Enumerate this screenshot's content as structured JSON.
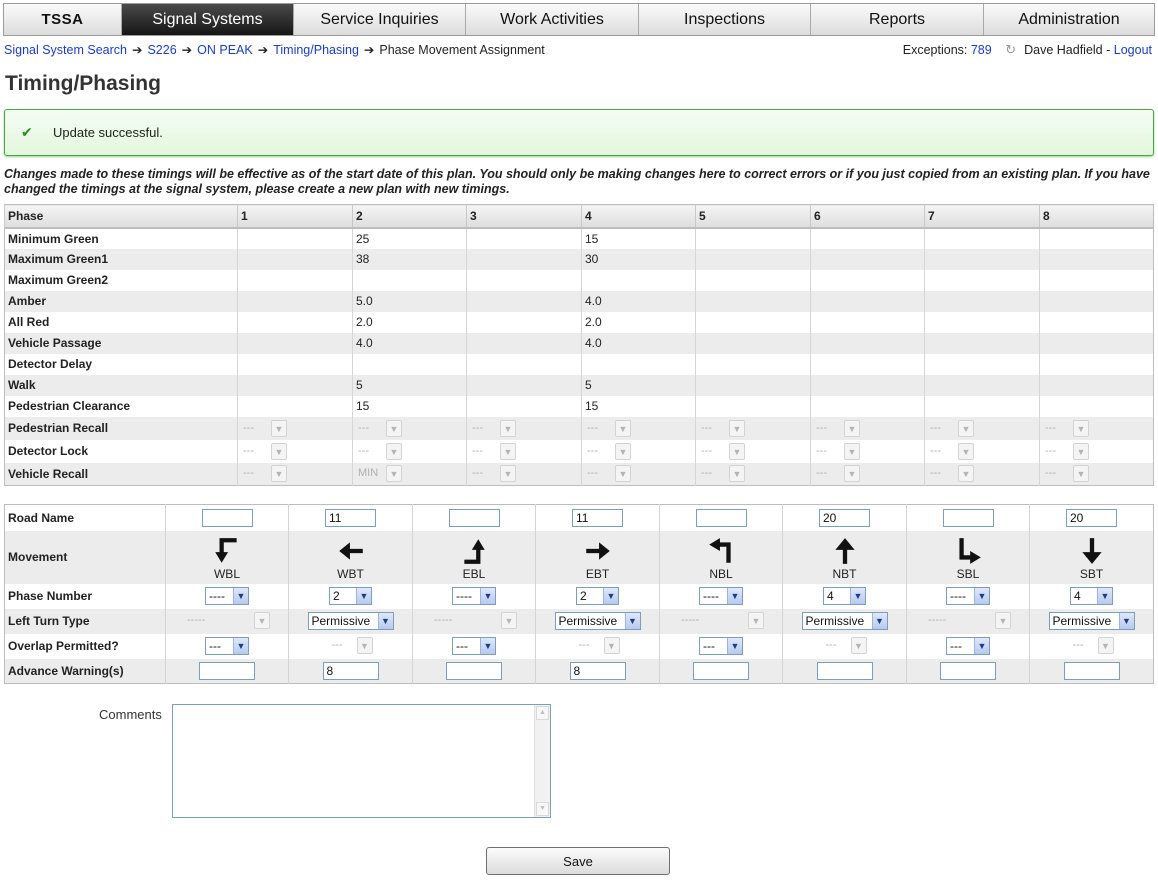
{
  "nav": {
    "brand": "TSSA",
    "tabs": [
      "Signal Systems",
      "Service Inquiries",
      "Work Activities",
      "Inspections",
      "Reports",
      "Administration"
    ],
    "active": "Signal Systems"
  },
  "breadcrumb": [
    "Signal System Search",
    "S226",
    "ON PEAK",
    "Timing/Phasing",
    "Phase Movement Assignment"
  ],
  "user": {
    "exceptions_label": "Exceptions:",
    "exceptions_count": "789",
    "refresh_icon": "refresh-icon",
    "name": "Dave Hadfield",
    "separator": "-",
    "logout": "Logout"
  },
  "page_title": "Timing/Phasing",
  "message": {
    "icon": "check-icon",
    "text": "Update successful."
  },
  "note": "Changes made to these timings will be effective as of the start date of this plan. You should only be making changes here to correct errors or if you just copied from an existing plan. If you have changed the timings at the signal system, please create a new plan with new timings.",
  "timing": {
    "header": [
      "Phase",
      "1",
      "2",
      "3",
      "4",
      "5",
      "6",
      "7",
      "8"
    ],
    "rows": [
      {
        "label": "Minimum Green",
        "values": [
          "",
          "25",
          "",
          "15",
          "",
          "",
          "",
          ""
        ]
      },
      {
        "label": "Maximum Green1",
        "values": [
          "",
          "38",
          "",
          "30",
          "",
          "",
          "",
          ""
        ]
      },
      {
        "label": "Maximum Green2",
        "values": [
          "",
          "",
          "",
          "",
          "",
          "",
          "",
          ""
        ]
      },
      {
        "label": "Amber",
        "values": [
          "",
          "5.0",
          "",
          "4.0",
          "",
          "",
          "",
          ""
        ]
      },
      {
        "label": "All Red",
        "values": [
          "",
          "2.0",
          "",
          "2.0",
          "",
          "",
          "",
          ""
        ]
      },
      {
        "label": "Vehicle Passage",
        "values": [
          "",
          "4.0",
          "",
          "4.0",
          "",
          "",
          "",
          ""
        ]
      },
      {
        "label": "Detector Delay",
        "values": [
          "",
          "",
          "",
          "",
          "",
          "",
          "",
          ""
        ]
      },
      {
        "label": "Walk",
        "values": [
          "",
          "5",
          "",
          "5",
          "",
          "",
          "",
          ""
        ]
      },
      {
        "label": "Pedestrian Clearance",
        "values": [
          "",
          "15",
          "",
          "15",
          "",
          "",
          "",
          ""
        ]
      }
    ],
    "select_rows": [
      {
        "label": "Pedestrian Recall",
        "values": [
          "---",
          "---",
          "---",
          "---",
          "---",
          "---",
          "---",
          "---"
        ]
      },
      {
        "label": "Detector Lock",
        "values": [
          "---",
          "---",
          "---",
          "---",
          "---",
          "---",
          "---",
          "---"
        ]
      },
      {
        "label": "Vehicle Recall",
        "values": [
          "---",
          "MIN",
          "---",
          "---",
          "---",
          "---",
          "---",
          "---"
        ]
      }
    ]
  },
  "movements": {
    "labels": {
      "road_name": "Road Name",
      "movement": "Movement",
      "phase_number": "Phase Number",
      "left_turn_type": "Left Turn Type",
      "overlap_permitted": "Overlap Permitted?",
      "advance_warning": "Advance Warning(s)"
    },
    "columns": [
      {
        "code": "WBL",
        "icon": "arrow-down-left-turn-icon",
        "road": "",
        "phase": "----",
        "phase_enabled": true,
        "left_turn": "-----",
        "left_turn_enabled": false,
        "overlap": "---",
        "overlap_enabled": true,
        "warning": ""
      },
      {
        "code": "WBT",
        "icon": "arrow-left-icon",
        "road": "11",
        "phase": "2",
        "phase_enabled": true,
        "left_turn": "Permissive",
        "left_turn_enabled": true,
        "overlap": "---",
        "overlap_enabled": false,
        "warning": "8"
      },
      {
        "code": "EBL",
        "icon": "arrow-up-left-turn-icon",
        "road": "",
        "phase": "----",
        "phase_enabled": true,
        "left_turn": "-----",
        "left_turn_enabled": false,
        "overlap": "---",
        "overlap_enabled": true,
        "warning": ""
      },
      {
        "code": "EBT",
        "icon": "arrow-right-icon",
        "road": "11",
        "phase": "2",
        "phase_enabled": true,
        "left_turn": "Permissive",
        "left_turn_enabled": true,
        "overlap": "---",
        "overlap_enabled": false,
        "warning": "8"
      },
      {
        "code": "NBL",
        "icon": "arrow-left-up-turn-icon",
        "road": "",
        "phase": "----",
        "phase_enabled": true,
        "left_turn": "-----",
        "left_turn_enabled": false,
        "overlap": "---",
        "overlap_enabled": true,
        "warning": ""
      },
      {
        "code": "NBT",
        "icon": "arrow-up-icon",
        "road": "20",
        "phase": "4",
        "phase_enabled": true,
        "left_turn": "Permissive",
        "left_turn_enabled": true,
        "overlap": "---",
        "overlap_enabled": false,
        "warning": ""
      },
      {
        "code": "SBL",
        "icon": "arrow-down-right-turn-icon",
        "road": "",
        "phase": "----",
        "phase_enabled": true,
        "left_turn": "-----",
        "left_turn_enabled": false,
        "overlap": "---",
        "overlap_enabled": true,
        "warning": ""
      },
      {
        "code": "SBT",
        "icon": "arrow-down-icon",
        "road": "20",
        "phase": "4",
        "phase_enabled": true,
        "left_turn": "Permissive",
        "left_turn_enabled": true,
        "overlap": "---",
        "overlap_enabled": false,
        "warning": ""
      }
    ]
  },
  "comments": {
    "label": "Comments",
    "value": ""
  },
  "save_label": "Save",
  "dropdown_arrow": "▼",
  "colors": {
    "nav_active": "#2a2a2a",
    "link": "#1a3cc8",
    "success_border": "#48a842",
    "success_bg": "#e9f8e5"
  }
}
